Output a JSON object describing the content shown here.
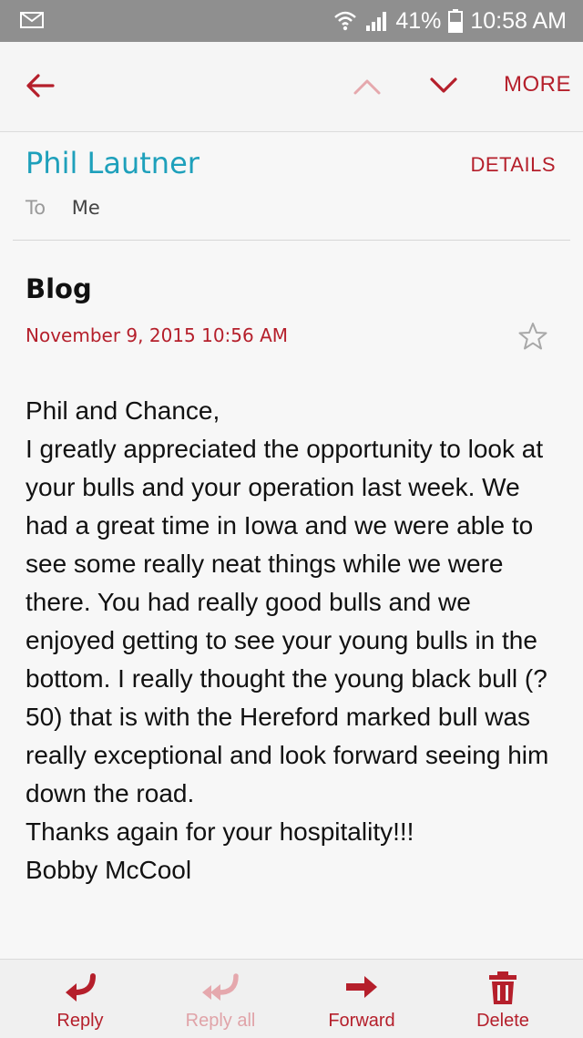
{
  "status_bar": {
    "battery": "41%",
    "time": "10:58 AM"
  },
  "toolbar": {
    "more_label": "MORE"
  },
  "email": {
    "sender": "Phil Lautner",
    "details_label": "DETAILS",
    "to_label": "To",
    "to_value": "Me",
    "subject": "Blog",
    "date": "November 9, 2015  10:56 AM",
    "body": [
      "Phil and Chance,",
      "I greatly appreciated the opportunity to look at your bulls and your operation last week. We had a great time in Iowa and we were able to see some really neat things while we were there. You had really good bulls and we enjoyed getting to see your young bulls in the bottom. I really thought the young black bull (?50) that is with the Hereford marked bull was really exceptional and look forward seeing him down the road.",
      "Thanks again for your hospitality!!!",
      "Bobby McCool"
    ]
  },
  "bottom_bar": {
    "reply": "Reply",
    "reply_all": "Reply all",
    "forward": "Forward",
    "delete": "Delete"
  },
  "colors": {
    "accent": "#b51f2b",
    "sender": "#1ea0bb",
    "status_bar": "#8f8f8f"
  },
  "icons": [
    "mail-icon",
    "wifi-icon",
    "signal-icon",
    "battery-icon",
    "back-arrow-icon",
    "chevron-up-icon",
    "chevron-down-icon",
    "star-icon",
    "reply-icon",
    "reply-all-icon",
    "forward-icon",
    "trash-icon"
  ]
}
